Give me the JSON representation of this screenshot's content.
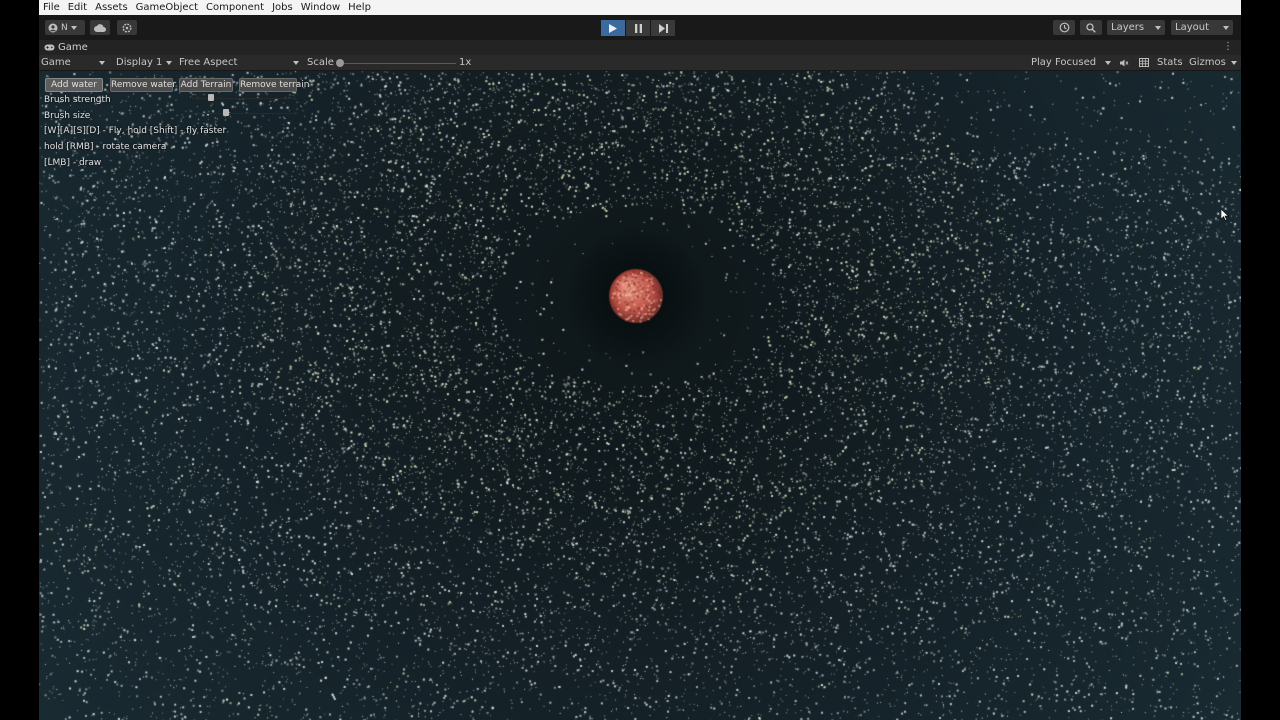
{
  "menu": {
    "items": [
      "File",
      "Edit",
      "Assets",
      "GameObject",
      "Component",
      "Jobs",
      "Window",
      "Help"
    ]
  },
  "toolbar": {
    "account_label": "N",
    "account_icon": "user-circle-icon",
    "cloud_icon": "cloud-icon",
    "settings_icon": "gear-icon",
    "play_icon": "play-icon",
    "pause_icon": "pause-icon",
    "step_icon": "step-icon",
    "history_icon": "history-icon",
    "search_icon": "search-icon",
    "layers_label": "Layers",
    "layout_label": "Layout",
    "play_active_color": "#3a6a9e"
  },
  "tab": {
    "icon": "gamepad-icon",
    "label": "Game"
  },
  "game_toolbar": {
    "view_select": "Game",
    "display_select": "Display 1",
    "aspect_select": "Free Aspect",
    "scale_label": "Scale",
    "scale_value": "1x",
    "scale_level": 0,
    "play_mode": "Play Focused",
    "mute_icon": "mute-audio-icon",
    "stats_icon": "stats-grid-icon",
    "stats_label": "Stats",
    "gizmos_label": "Gizmos"
  },
  "gui": {
    "buttons": [
      "Add water",
      "Remove water",
      "Add Terrain",
      "Remove terrain"
    ],
    "brush_strength_label": "Brush strength",
    "brush_strength_level": 0.16,
    "brush_size_label": "Brush size",
    "brush_size_level": 0.32,
    "help": [
      "[W][A][S][D] - Fly, hold [Shift] - fly faster",
      "hold [RMB] - rotate camera",
      "[LMB] - draw"
    ]
  },
  "scene": {
    "planet_color": "#c0564a",
    "particle_color": "#e8eed8",
    "background_color": "#15212a"
  }
}
